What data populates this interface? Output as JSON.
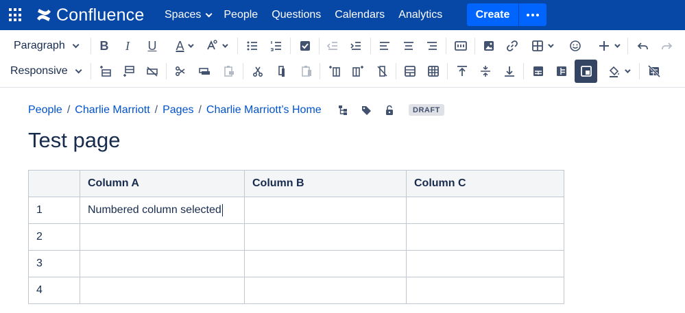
{
  "topnav": {
    "product": "Confluence",
    "links": [
      {
        "label": "Spaces",
        "has_dropdown": true
      },
      {
        "label": "People",
        "has_dropdown": false
      },
      {
        "label": "Questions",
        "has_dropdown": false
      },
      {
        "label": "Calendars",
        "has_dropdown": false
      },
      {
        "label": "Analytics",
        "has_dropdown": false
      }
    ],
    "create_label": "Create",
    "brand_color": "#0747A6",
    "create_color": "#0065FF"
  },
  "toolbar": {
    "paragraph_select": "Paragraph",
    "width_select": "Responsive",
    "bold": "B",
    "italic": "I",
    "underline": "U",
    "text_color": "A"
  },
  "breadcrumb": {
    "items": [
      "People",
      "Charlie Marriott",
      "Pages",
      "Charlie Marriott’s Home"
    ],
    "separator": "/"
  },
  "status_badge": "DRAFT",
  "page_title": "Test page",
  "table": {
    "headers": [
      "",
      "Column A",
      "Column B",
      "Column C"
    ],
    "rows": [
      [
        "1",
        "Numbered column selected",
        "",
        ""
      ],
      [
        "2",
        "",
        "",
        ""
      ],
      [
        "3",
        "",
        "",
        ""
      ],
      [
        "4",
        "",
        "",
        ""
      ]
    ]
  }
}
